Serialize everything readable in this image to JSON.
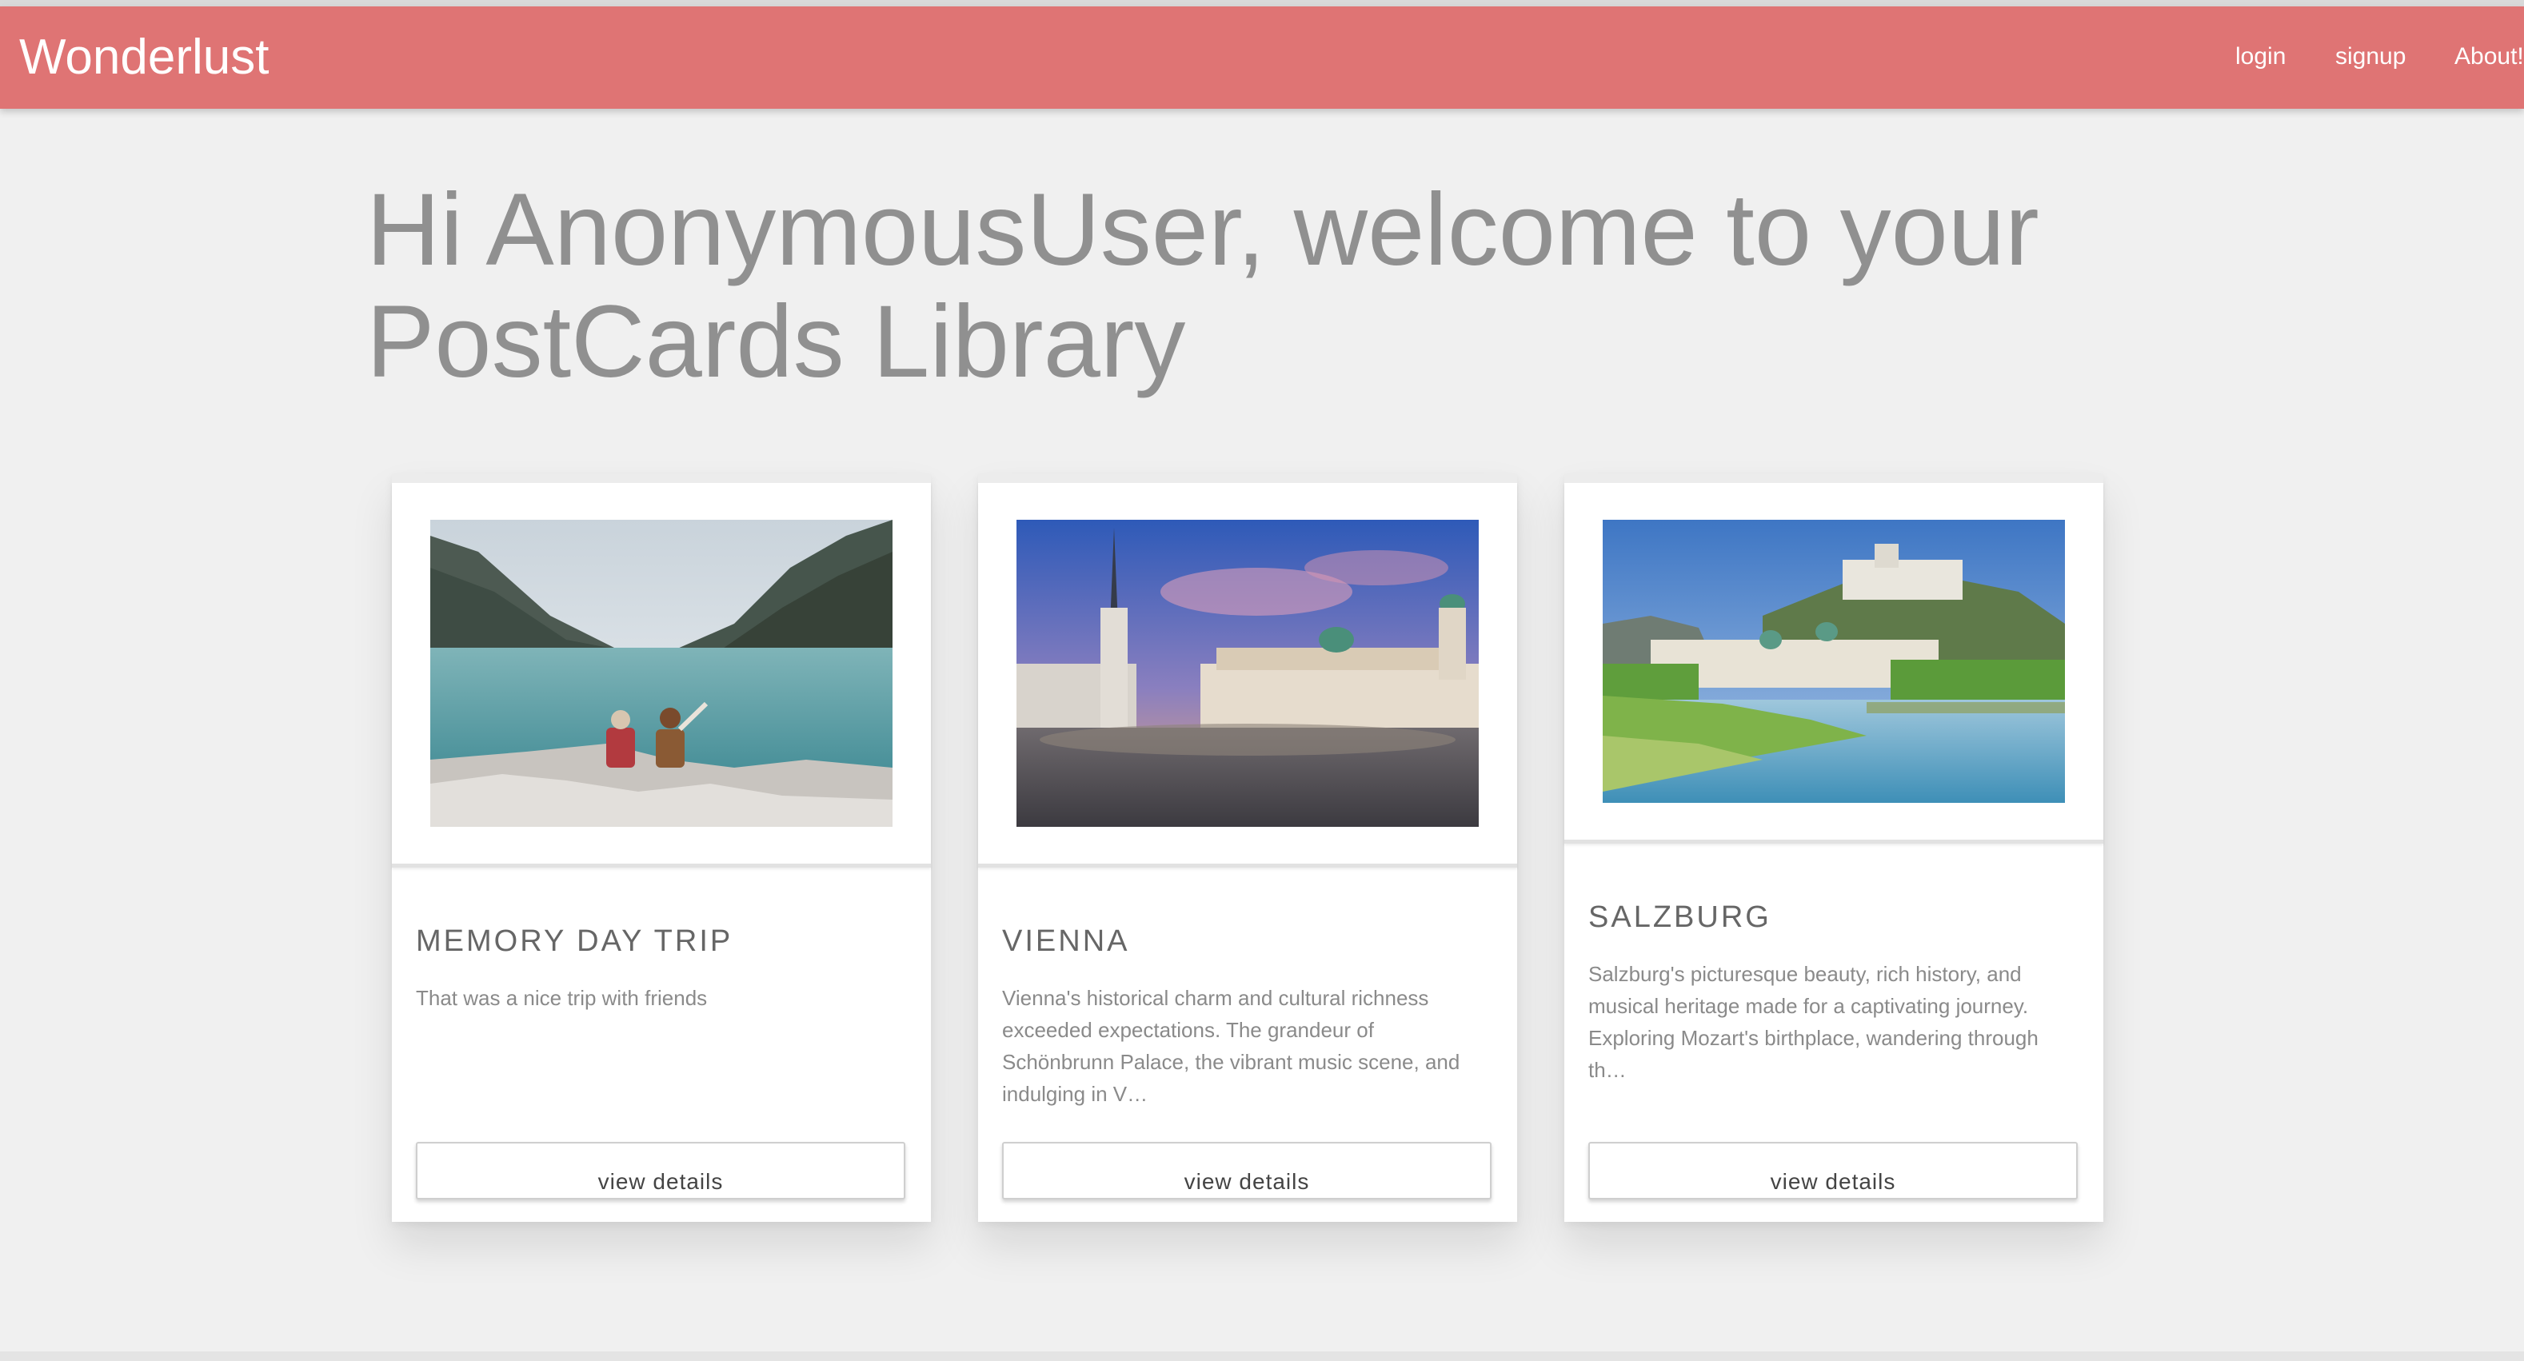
{
  "navbar": {
    "brand": "Wonderlust",
    "links": [
      {
        "label": "login"
      },
      {
        "label": "signup"
      },
      {
        "label": "About!"
      }
    ],
    "color": "#df7474"
  },
  "welcome": {
    "line1": "Hi AnonymousUser, welcome to your",
    "line2": "PostCards Library"
  },
  "cards": [
    {
      "title": "MEMORY DAY TRIP",
      "description": "That was a nice trip with friends",
      "button_label": "view details",
      "image": "mountain-lake-photo"
    },
    {
      "title": "VIENNA",
      "description": "Vienna's historical charm and cultural richness exceeded expectations. The grandeur of Schönbrunn Palace, the vibrant music scene, and indulging in V…",
      "button_label": "view details",
      "image": "vienna-square-photo"
    },
    {
      "title": "SALZBURG",
      "description": "Salzburg's picturesque beauty, rich history, and musical heritage made for a captivating journey. Exploring Mozart's birthplace, wandering through th…",
      "button_label": "view details",
      "image": "salzburg-river-photo"
    }
  ]
}
